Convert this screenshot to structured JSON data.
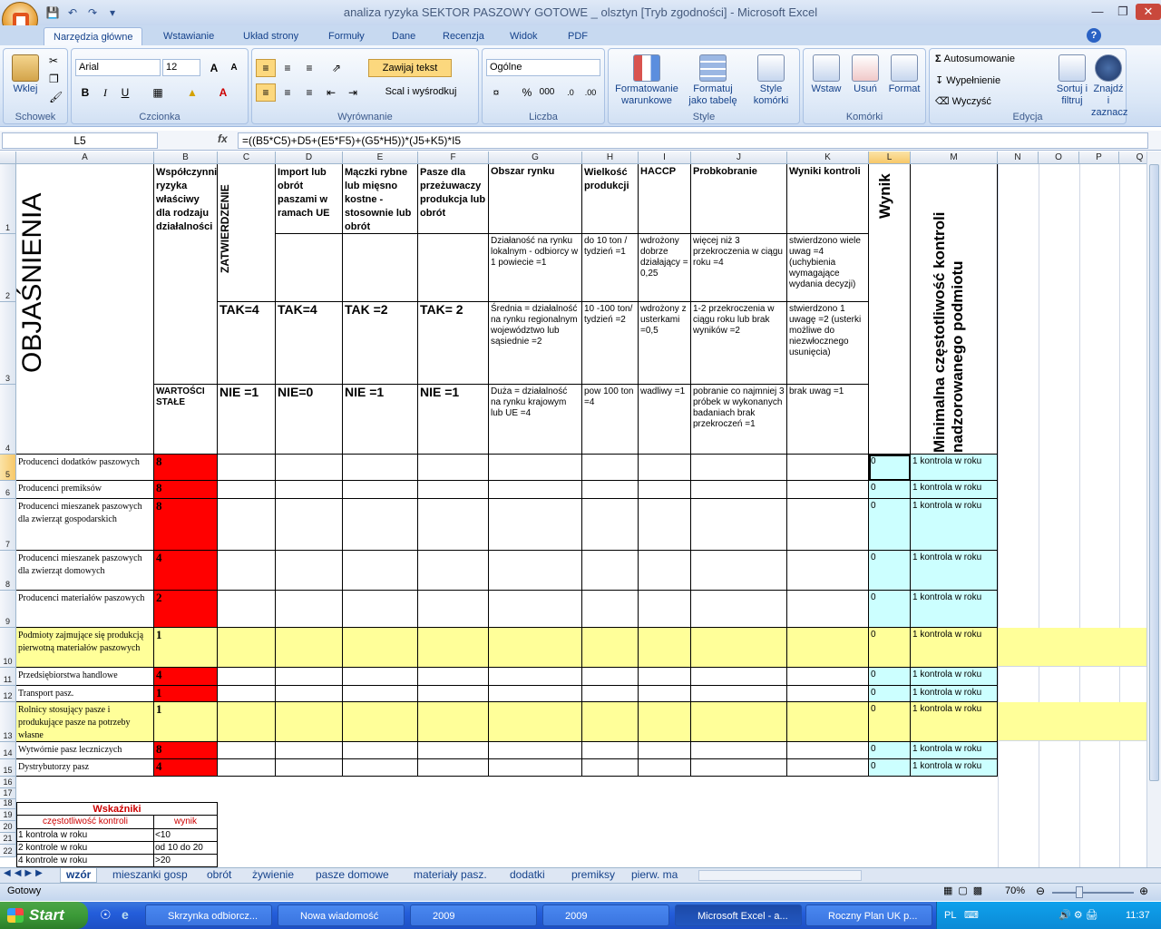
{
  "window": {
    "title": "analiza ryzyka SEKTOR PASZOWY GOTOWE _ olsztyn  [Tryb zgodności] - Microsoft Excel"
  },
  "tabs": [
    "Narzędzia główne",
    "Wstawianie",
    "Układ strony",
    "Formuły",
    "Dane",
    "Recenzja",
    "Widok",
    "PDF"
  ],
  "ribbon": {
    "clipboard": {
      "paste": "Wklej",
      "label": "Schowek"
    },
    "font": {
      "name": "Arial",
      "size": "12",
      "label": "Czcionka",
      "bold": "B",
      "italic": "I",
      "underline": "U"
    },
    "align": {
      "wrap": "Zawijaj tekst",
      "merge": "Scal i wyśrodkuj",
      "label": "Wyrównanie"
    },
    "number": {
      "format": "Ogólne",
      "label": "Liczba",
      "percent": "%",
      "thousands": "000"
    },
    "styles": {
      "cond": "Formatowanie warunkowe",
      "table": "Formatuj jako tabelę",
      "cell": "Style komórki",
      "label": "Style"
    },
    "cells": {
      "insert": "Wstaw",
      "delete": "Usuń",
      "format": "Format",
      "label": "Komórki"
    },
    "edit": {
      "autosum": "Autosumowanie",
      "fill": "Wypełnienie",
      "clear": "Wyczyść",
      "sort": "Sortuj i filtruj",
      "find": "Znajdź i zaznacz",
      "label": "Edycja"
    }
  },
  "formula_bar": {
    "cell": "L5",
    "fx": "fx",
    "formula": "=((B5*C5)+D5+(E5*F5)+(G5*H5))*(J5+K5)*I5"
  },
  "columns": [
    "A",
    "B",
    "C",
    "D",
    "E",
    "F",
    "G",
    "H",
    "I",
    "J",
    "K",
    "L",
    "M",
    "N",
    "O",
    "P",
    "Q"
  ],
  "rows": [
    "1",
    "2",
    "3",
    "4",
    "5",
    "6",
    "7",
    "8",
    "9",
    "10",
    "11",
    "12",
    "13",
    "14",
    "15",
    "16",
    "17",
    "18",
    "19",
    "20",
    "21",
    "22"
  ],
  "header": {
    "objasnienia": "OBJAŚNIENIA",
    "b1": "Współczynnik ryzyka właściwy dla rodzaju działalności",
    "c_rot": "ZATWIERDZENIE",
    "d1": "Import lub obrót paszami w ramach UE",
    "e1": "Mączki rybne lub mięsno kostne - stosownie lub obrót",
    "f1": "Pasze dla przeżuwaczy produkcja lub obrót",
    "g1": "Obszar rynku",
    "h1": "Wielkość produkcji",
    "i1": "HACCP",
    "j1": "Probkobranie",
    "k1": "Wyniki kontroli",
    "l1": "Wynik",
    "m1": "Minimalna częstotliwość kontroli nadzorowanego podmiotu",
    "g2": "Działaność na rynku lokalnym - odbiorcy w 1 powiecie =1",
    "h2": "do 10 ton / tydzień =1",
    "i2": "wdrożony dobrze działający = 0,25",
    "j2": "więcej niż 3 przekroczenia w ciągu roku =4",
    "k2": "stwierdzono wiele uwag =4 (uchybienia wymagające wydania decyzji)",
    "c3": "TAK=4",
    "d3": "TAK=4",
    "e3": "TAK =2",
    "f3": "TAK= 2",
    "g3": "Średnia = działalność na rynku regionalnym województwo lub sąsiednie =2",
    "h3": "10 -100 ton/ tydzień =2",
    "i3": "wdrożony z usterkami =0,5",
    "j3": "1-2 przekroczenia w ciągu roku lub brak wyników =2",
    "k3": "stwierdzono 1 uwagę =2 (usterki możliwe do niezwłocznego usunięcia)",
    "b4": "WARTOŚCI STAŁE",
    "c4": "NIE =1",
    "d4": "NIE=0",
    "e4": "NIE =1",
    "f4": "NIE =1",
    "g4": "Duża = działalność na rynku krajowym lub UE =4",
    "h4": "pow 100 ton =4",
    "i4": "wadliwy =1",
    "j4": "pobranie co najmniej 3 próbek w wykonanych badaniach brak przekroczeń =1",
    "k4": "brak uwag =1"
  },
  "data_rows": [
    {
      "a": "Producenci dodatków paszowych",
      "b": "8",
      "l": "0",
      "m": "1 kontrola w roku"
    },
    {
      "a": "Producenci premiksów",
      "b": "8",
      "l": "0",
      "m": "1 kontrola w roku"
    },
    {
      "a": "Producenci mieszanek paszowych dla zwierząt gospodarskich",
      "b": "8",
      "l": "0",
      "m": "1 kontrola w roku"
    },
    {
      "a": "Producenci mieszanek paszowych dla zwierząt domowych",
      "b": "4",
      "l": "0",
      "m": "1 kontrola w roku"
    },
    {
      "a": "Producenci materiałów paszowych",
      "b": "2",
      "l": "0",
      "m": "1 kontrola w roku"
    },
    {
      "a": "Podmioty zajmujące się produkcją pierwotną materiałów paszowych",
      "b": "1",
      "l": "0",
      "m": "1 kontrola w roku"
    },
    {
      "a": "Przedsiębiorstwa handlowe",
      "b": "4",
      "l": "0",
      "m": "1 kontrola w roku"
    },
    {
      "a": "Transport pasz.",
      "b": "1",
      "l": "0",
      "m": "1 kontrola w roku"
    },
    {
      "a": "Rolnicy stosujący pasze i produkujące pasze na potrzeby własne",
      "b": "1",
      "l": "0",
      "m": "1 kontrola w roku"
    },
    {
      "a": "Wytwórnie pasz leczniczych",
      "b": "8",
      "l": "0",
      "m": "1 kontrola w roku"
    },
    {
      "a": "Dystrybutorzy pasz",
      "b": "4",
      "l": "0",
      "m": "1 kontrola w roku"
    }
  ],
  "legend": {
    "title": "Wskaźniki",
    "col1": "częstotliwość kontroli",
    "col2": "wynik",
    "rows": [
      {
        "a": "1 kontrola w roku",
        "b": "<10"
      },
      {
        "a": "2 kontrole w roku",
        "b": "od 10 do 20"
      },
      {
        "a": "4 kontrole w roku",
        "b": ">20"
      }
    ]
  },
  "sheets": [
    "wzór",
    "mieszanki gosp",
    "obrót",
    "żywienie",
    "pasze domowe",
    "materiały pasz.",
    "dodatki",
    "premiksy",
    "pierw. ma"
  ],
  "status": {
    "ready": "Gotowy",
    "zoom": "70%"
  },
  "taskbar": {
    "start": "Start",
    "items": [
      "Skrzynka odbiorcz...",
      "Nowa wiadomość",
      "2009",
      "2009",
      "Microsoft Excel - a...",
      "Roczny  Plan UK p..."
    ],
    "lang": "PL",
    "time": "11:37"
  },
  "colors": {
    "red": "#ff0000",
    "yellow": "#ffff99",
    "cyan": "#ccffff"
  }
}
